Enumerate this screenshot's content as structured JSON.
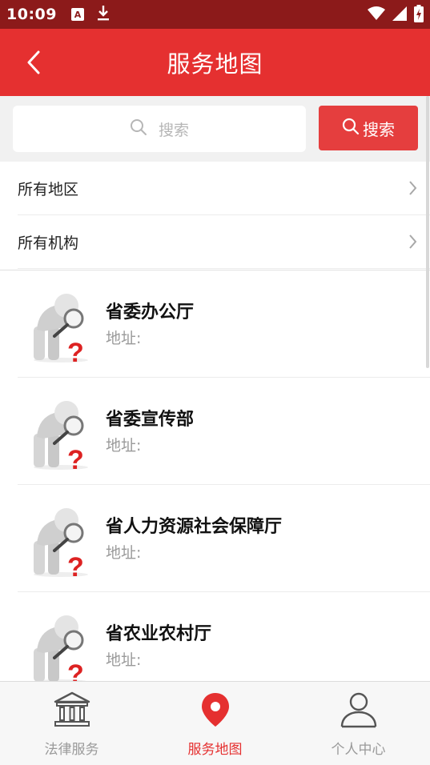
{
  "status_bar": {
    "time": "10:09",
    "notif_letter": "A"
  },
  "header": {
    "title": "服务地图"
  },
  "search": {
    "placeholder": "搜索",
    "button_label": "搜索"
  },
  "filters": [
    {
      "label": "所有地区"
    },
    {
      "label": "所有机构"
    }
  ],
  "organizations": [
    {
      "name": "省委办公厅",
      "address_label": "地址:"
    },
    {
      "name": "省委宣传部",
      "address_label": "地址:"
    },
    {
      "name": "省人力资源社会保障厅",
      "address_label": "地址:"
    },
    {
      "name": "省农业农村厅",
      "address_label": "地址:"
    }
  ],
  "bottom_nav": [
    {
      "label": "法律服务",
      "icon": "courthouse-icon",
      "active": false
    },
    {
      "label": "服务地图",
      "icon": "map-pin-icon",
      "active": true
    },
    {
      "label": "个人中心",
      "icon": "person-icon",
      "active": false
    }
  ],
  "colors": {
    "primary_red": "#e53030",
    "status_bar": "#8c1a1a",
    "search_button": "#e53e3e"
  }
}
